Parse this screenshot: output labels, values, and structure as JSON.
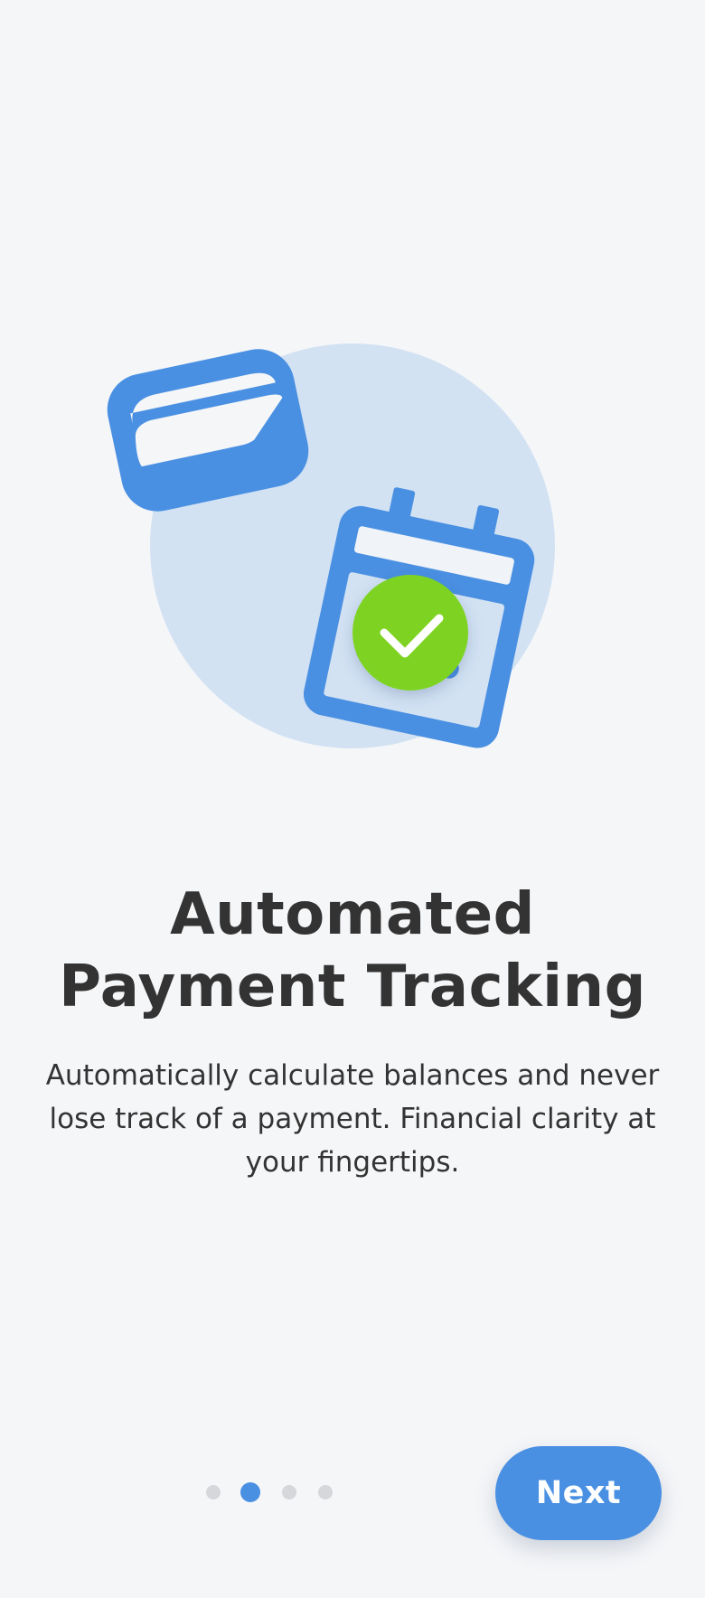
{
  "onboarding": {
    "title": "Automated Payment Tracking",
    "description": "Automatically calculate balances and never lose track of a payment. Financial clarity at your fingertips.",
    "next_label": "Next"
  },
  "pagination": {
    "total_pages": 4,
    "active_index": 1
  },
  "illustration": {
    "icons": [
      "credit-card-icon",
      "calendar-icon",
      "check-circle-icon"
    ]
  },
  "colors": {
    "background": "#f5f6f8",
    "accent": "#4a90e2",
    "accent_light": "#d3e2f3",
    "success": "#7ed321",
    "text": "#333333",
    "dot_inactive": "#d6d7db"
  }
}
